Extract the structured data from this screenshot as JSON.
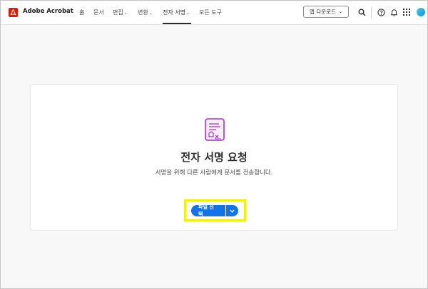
{
  "app": {
    "brand": "Adobe Acrobat"
  },
  "nav": {
    "items": [
      {
        "label": "홈",
        "dropdown": false
      },
      {
        "label": "문서",
        "dropdown": false
      },
      {
        "label": "편집",
        "dropdown": true
      },
      {
        "label": "변환",
        "dropdown": true
      },
      {
        "label": "전자 서명",
        "dropdown": true,
        "active": true
      },
      {
        "label": "모든 도구",
        "dropdown": false
      }
    ]
  },
  "header_actions": {
    "app_download_label": "앱 다운로드",
    "icons": [
      "search-icon",
      "help-icon",
      "notification-bell-icon",
      "apps-grid-icon",
      "avatar"
    ]
  },
  "main": {
    "title": "전자 서명 요청",
    "subtitle": "서명을 위해 다른 사람에게 문서를 전송합니다.",
    "primary_button_label": "파일 선택",
    "split_icon": "chevron-down-icon"
  },
  "colors": {
    "accent": "#1473e6",
    "brand_red": "#d81e05",
    "icon_magenta": "#a931c7",
    "highlight": "#f2f20a"
  }
}
